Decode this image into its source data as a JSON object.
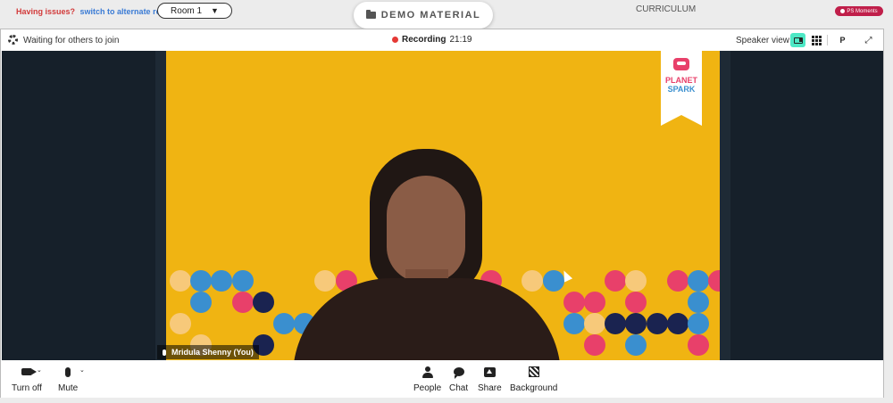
{
  "header": {
    "issues_question": "Having issues?",
    "issues_link": "switch to alternate room",
    "room_selected": "Room 1",
    "demo_material_label": "DEMO MATERIAL",
    "curriculum_label": "CURRICULUM",
    "ps_moments_label": "PS Moments"
  },
  "call_bar": {
    "status_text": "Waiting for others to join",
    "recording_label": "Recording",
    "recording_time": "21:19",
    "view_label": "Speaker view",
    "p_button_label": "P"
  },
  "video": {
    "participant_name": "Mridula Shenny (You)",
    "logo_line1": "PLANET",
    "logo_line2": "SPARK"
  },
  "controls": {
    "camera_label": "Turn off",
    "mic_label": "Mute",
    "people_label": "People",
    "chat_label": "Chat",
    "share_label": "Share",
    "background_label": "Background"
  },
  "colors": {
    "accent": "#4de8c5",
    "recording": "#e53935",
    "backdrop_yellow": "#f0b412",
    "brand_pink": "#c01f4a"
  },
  "icons": [
    "folder-icon",
    "gear-icon",
    "speaker-view-icon",
    "grid-view-icon",
    "expand-icon",
    "camera-icon",
    "mic-icon",
    "people-icon",
    "chat-icon",
    "share-icon",
    "background-icon"
  ]
}
